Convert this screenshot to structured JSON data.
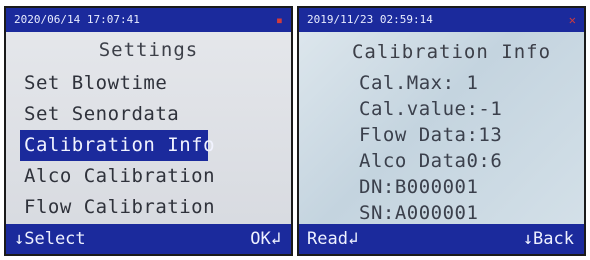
{
  "left_screen": {
    "status": {
      "datetime": "2020/06/14 17:07:41",
      "icon": "battery-icon"
    },
    "title": "Settings",
    "menu": [
      {
        "label": "Set Blowtime",
        "selected": false
      },
      {
        "label": "Set Senordata",
        "selected": false
      },
      {
        "label": "Calibration Info",
        "selected": true
      },
      {
        "label": "Alco Calibration",
        "selected": false
      },
      {
        "label": "Flow Calibration",
        "selected": false
      }
    ],
    "softkeys": {
      "left": "↓Select",
      "right": "OK↲"
    }
  },
  "right_screen": {
    "status": {
      "datetime": "2019/11/23 02:59:14",
      "icon": "close-icon"
    },
    "title": "Calibration Info",
    "lines": [
      "Cal.Max: 1",
      "Cal.value:-1",
      "Flow Data:13",
      "Alco Data0:6",
      "DN:B000001",
      "SN:A000001"
    ],
    "softkeys": {
      "left": "Read↲",
      "right": "↓Back"
    }
  },
  "colors": {
    "accent": "#1b2a9c",
    "screen_bg": "#e6e8ec",
    "text": "#2f323b",
    "status_icon": "#d23b3b"
  }
}
